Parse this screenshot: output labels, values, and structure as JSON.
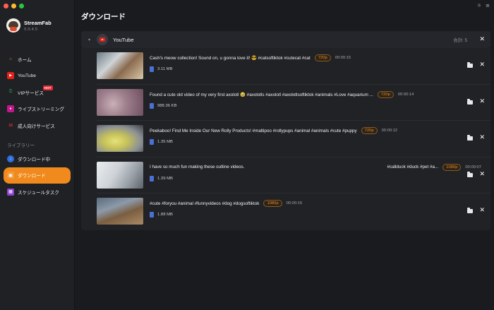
{
  "app": {
    "brand_name": "StreamFab",
    "version": "5.0.4.5",
    "page_title": "ダウンロード",
    "colors": {
      "accent": "#f08a1d",
      "background": "#1a1b1f",
      "sidebar": "#202125",
      "hot_badge": "#e32a35",
      "youtube_red": "#e62117"
    }
  },
  "window_controls": {
    "close": "close-dot",
    "minimize": "minimize-dot",
    "maximize": "maximize-dot"
  },
  "top_icons": {
    "theme": "☼",
    "menu": "≡"
  },
  "sidebar": {
    "items": [
      {
        "label": "ホーム",
        "icon": "home-icon",
        "glyph": "⌂"
      },
      {
        "label": "YouTube",
        "icon": "youtube-icon",
        "glyph": "▶"
      },
      {
        "label": "VIPサービス",
        "icon": "key-icon",
        "glyph": "⚿",
        "badge": "HOT"
      },
      {
        "label": "ライブストリーミング",
        "icon": "live-icon",
        "glyph": "●"
      },
      {
        "label": "成人向けサービス",
        "icon": "adult-icon",
        "glyph": "18"
      }
    ],
    "library_title": "ライブラリー",
    "library_items": [
      {
        "label": "ダウンロード中",
        "icon": "download-icon",
        "glyph": "↓"
      },
      {
        "label": "ダウンロード",
        "icon": "downloaded-icon",
        "glyph": "▣",
        "active": true
      },
      {
        "label": "スケジュールタスク",
        "icon": "schedule-icon",
        "glyph": "▦"
      }
    ]
  },
  "group": {
    "caret": "▾",
    "title": "YouTube",
    "total": "合計: 5",
    "close": "✕"
  },
  "videos": [
    {
      "title": "Cash's meow collection! Sound on, u gonna love it! 😎 #catsoftiktok #cutecat #cat",
      "tags": "",
      "resolution": "720p",
      "duration": "00:00:15",
      "size": "3.11 MB"
    },
    {
      "title": "Found a cute old video of my very first axolotl 🥹 #axolotls #axolotl #axolotlsoftiktok #animals #Love #aquarium ...",
      "tags": "",
      "resolution": "720p",
      "duration": "00:00:14",
      "size": "988.36 KB"
    },
    {
      "title": "Peekaboo! Find Me Inside Our New Rolly Products! #maltipoo #rollypups #animal #animals #cute #puppy",
      "tags": "",
      "resolution": "720p",
      "duration": "00:00:12",
      "size": "1.35 MB"
    },
    {
      "title": "I have so much fun making these outline videos.",
      "tags": "#callduck #duck #pet #a...",
      "resolution": "1080p",
      "duration": "00:00:07",
      "size": "1.39 MB"
    },
    {
      "title": "#cute #foryou #animal #funnyvideos #dog #dogsoftiktok",
      "tags": "",
      "resolution": "1080p",
      "duration": "00:00:16",
      "size": "1.88 MB"
    }
  ]
}
